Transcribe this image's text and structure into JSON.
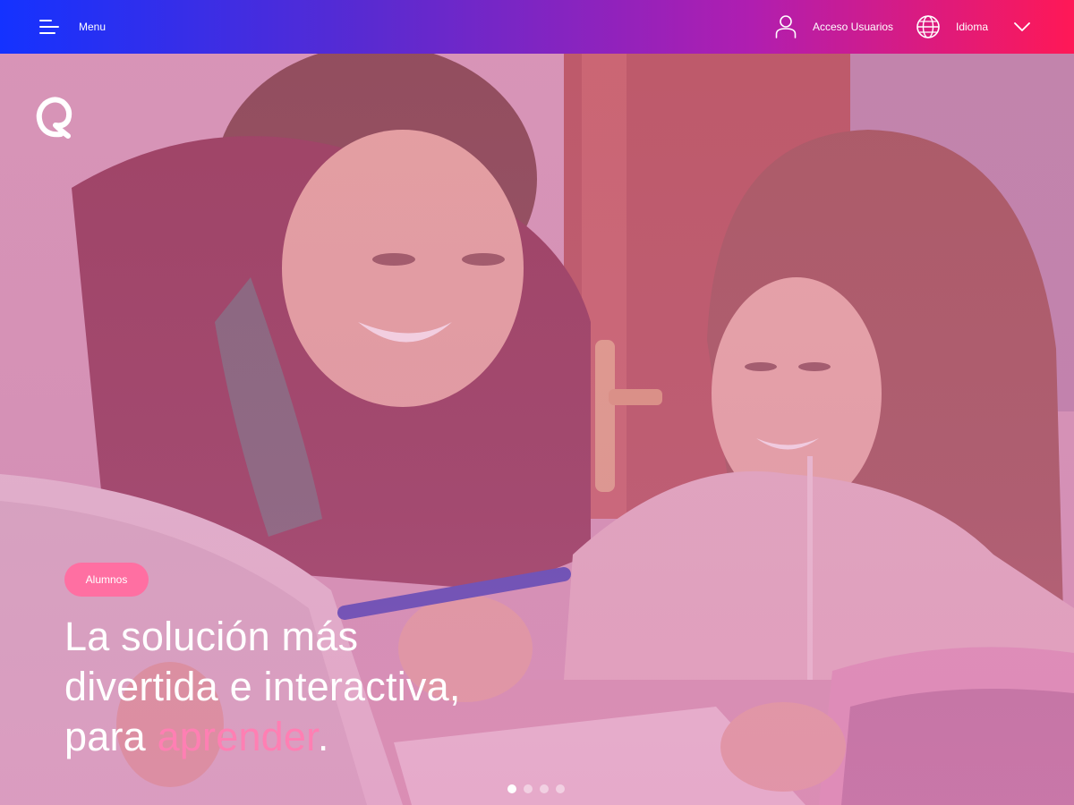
{
  "topbar": {
    "menu_label": "Menu",
    "access_label": "Acceso Usuarios",
    "language_label": "Idioma"
  },
  "hero": {
    "badge": "Alumnos",
    "headline_line1": "La solución más",
    "headline_line2": "divertida e interactiva,",
    "headline_line3_prefix": "para ",
    "headline_line3_accent": "aprender",
    "headline_line3_suffix": ".",
    "carousel_dot_count": 4,
    "carousel_active_index": 0
  },
  "colors": {
    "topbar_gradient_start": "#1432ff",
    "topbar_gradient_end": "#ff1856",
    "accent_pink": "#ff7fb3",
    "badge_pink": "#ff6fa2"
  },
  "icons": [
    "menu-icon",
    "user-icon",
    "globe-icon",
    "chevron-down-icon",
    "logo-icon"
  ]
}
